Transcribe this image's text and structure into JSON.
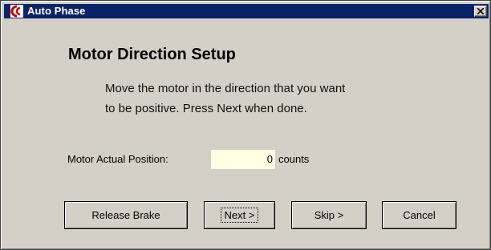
{
  "window": {
    "title": "Auto Phase",
    "title_bar_color": "#0a246a",
    "icon": "app-logo-icon",
    "close_icon": "close-icon"
  },
  "content": {
    "heading": "Motor Direction Setup",
    "instruction_line1": "Move the motor in the direction that you want",
    "instruction_line2": "to be positive.  Press Next when done."
  },
  "position": {
    "label": "Motor Actual Position:",
    "value": "0",
    "unit": "counts",
    "field_color": "#ffffe1"
  },
  "buttons": {
    "release_brake": "Release Brake",
    "next": "Next >",
    "skip": "Skip >",
    "cancel": "Cancel"
  }
}
